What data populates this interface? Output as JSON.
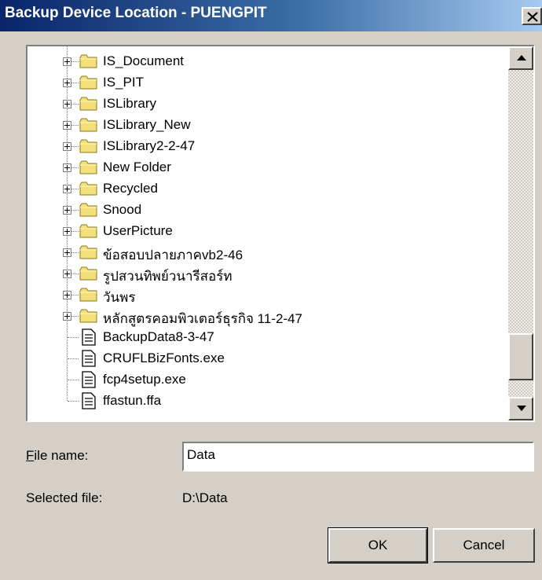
{
  "window": {
    "title": "Backup Device Location - PUENGPIT",
    "close_symbol": "×"
  },
  "tree": {
    "folders": [
      "IS_Document",
      "IS_PIT",
      "ISLibrary",
      "ISLibrary_New",
      "ISLibrary2-2-47",
      "New Folder",
      "Recycled",
      "Snood",
      "UserPicture",
      "ข้อสอบปลายภาคvb2-46",
      "รูปสวนทิพย์วนารีสอร์ท",
      "วันพร",
      "หลักสูตรคอมพิวเตอร์ธุรกิจ 11-2-47"
    ],
    "files": [
      "BackupData8-3-47",
      "CRUFLBizFonts.exe",
      "fcp4setup.exe",
      "ffastun.ffa"
    ],
    "folder_icon": "folder-icon",
    "file_icon": "document-icon",
    "colors": {
      "folder": "#f4e07a",
      "folder_edge": "#8a7a20"
    }
  },
  "form": {
    "file_name_label_accel": "F",
    "file_name_label_rest": "ile name:",
    "file_name_value": "Data",
    "selected_file_label": "Selected file:",
    "selected_file_value": "D:\\Data"
  },
  "buttons": {
    "ok": "OK",
    "cancel": "Cancel"
  }
}
